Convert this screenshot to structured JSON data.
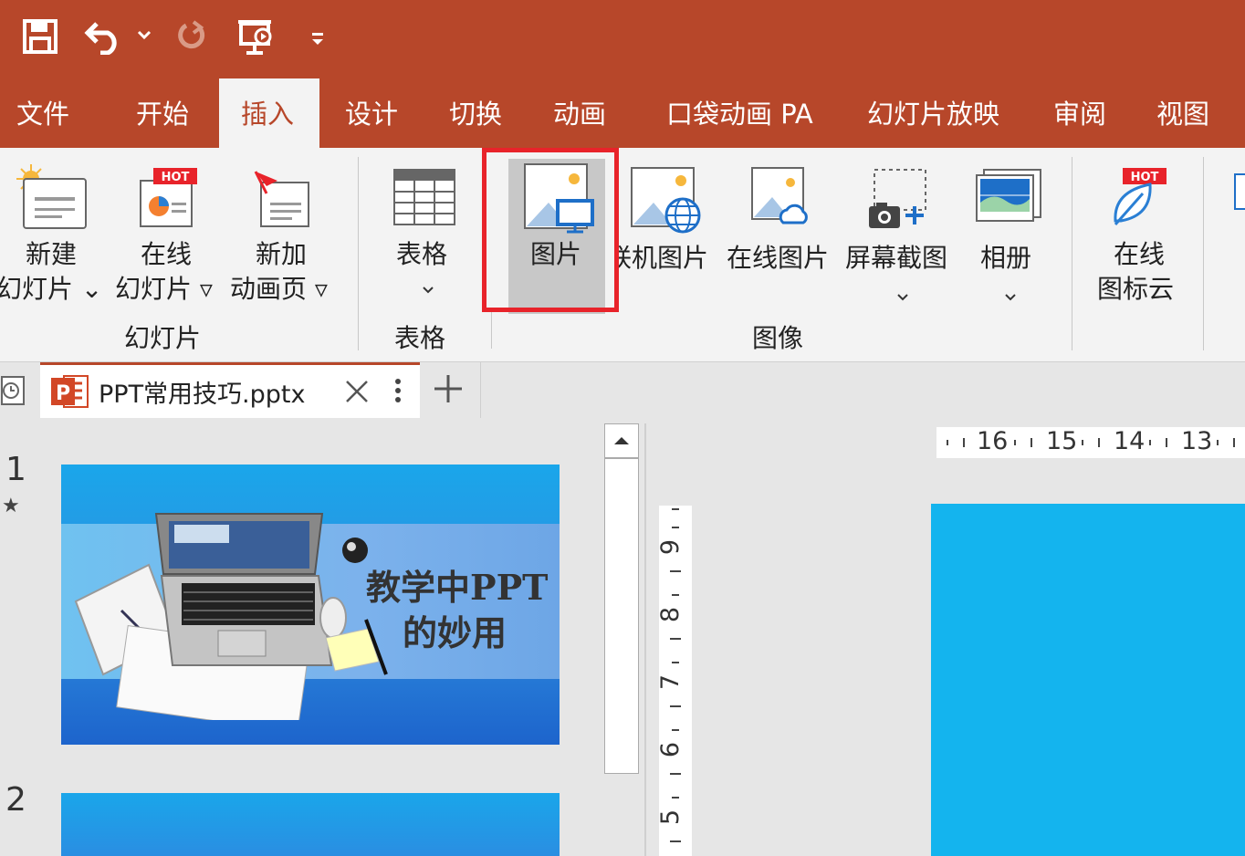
{
  "tabs": [
    "文件",
    "开始",
    "插入",
    "设计",
    "切换",
    "动画",
    "口袋动画 PA",
    "幻灯片放映",
    "审阅",
    "视图"
  ],
  "active_tab": "插入",
  "ribbon": {
    "new_slide": [
      "新建",
      "幻灯片 ⌄"
    ],
    "online_slide": [
      "在线",
      "幻灯片 ▿"
    ],
    "new_anim_page": [
      "新加",
      "动画页 ▿"
    ],
    "group_slides": "幻灯片",
    "table": "表格",
    "group_table": "表格",
    "picture": "图片",
    "online_picture": "联机图片",
    "online_picture_visible": "联机图片",
    "online_image": "在线图片",
    "screenshot": "屏幕截图",
    "album": "相册",
    "group_image": "图像",
    "icon_cloud": [
      "在线",
      "图标云"
    ],
    "hot": "HOT"
  },
  "document_tab": {
    "title": "PPT常用技巧.pptx"
  },
  "slides": [
    {
      "number": "1",
      "star": "★",
      "title_line1": "教学中PPT",
      "title_line2": "的妙用"
    },
    {
      "number": "2"
    }
  ],
  "ruler_h": [
    "16",
    "15",
    "14",
    "13"
  ],
  "ruler_v": [
    "9",
    "8",
    "7",
    "6",
    "5"
  ],
  "colors": {
    "accent": "#b7472a",
    "highlight": "#e8232a",
    "slide_blue": "#14b4ee"
  }
}
